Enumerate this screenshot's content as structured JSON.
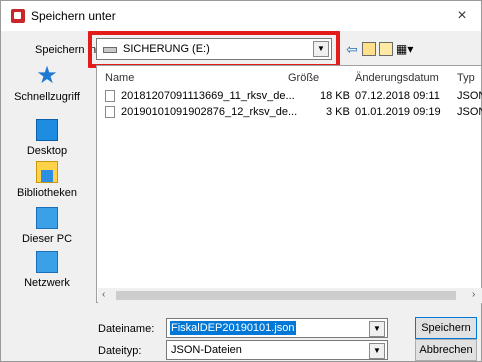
{
  "window": {
    "title": "Speichern unter",
    "close_label": "×"
  },
  "toolbar": {
    "look_in_label": "Speichern in:",
    "look_in_value": "SICHERUNG (E:)"
  },
  "places": [
    {
      "label": "Schnellzugriff",
      "icon": "star-icon"
    },
    {
      "label": "Desktop",
      "icon": "desktop-icon"
    },
    {
      "label": "Bibliotheken",
      "icon": "libraries-icon"
    },
    {
      "label": "Dieser PC",
      "icon": "this-pc-icon"
    },
    {
      "label": "Netzwerk",
      "icon": "network-icon"
    }
  ],
  "filelist": {
    "columns": [
      "Name",
      "Größe",
      "Änderungsdatum",
      "Typ"
    ],
    "rows": [
      {
        "name": "20181207091113669_11_rksv_de...",
        "size": "18 KB",
        "date": "07.12.2018 09:11",
        "type": "JSON"
      },
      {
        "name": "20190101091902876_12_rksv_de...",
        "size": "3 KB",
        "date": "01.01.2019 09:19",
        "type": "JSON"
      }
    ]
  },
  "bottom": {
    "filename_label": "Dateiname:",
    "filename_value": "FiskalDEP20190101.json",
    "filetype_label": "Dateityp:",
    "filetype_value": "JSON-Dateien",
    "save_label": "Speichern",
    "cancel_label": "Abbrechen"
  },
  "colors": {
    "highlight": "#e21b1b",
    "selection": "#0078d7"
  }
}
